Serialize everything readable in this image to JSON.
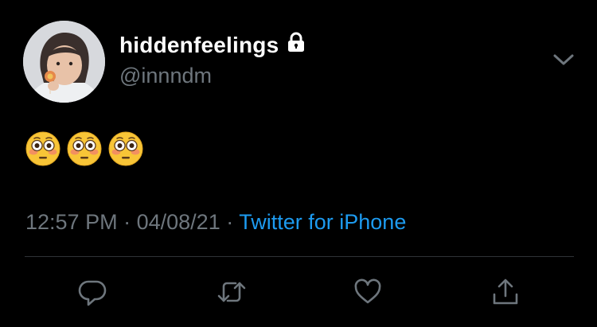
{
  "tweet": {
    "display_name": "hiddenfeelings",
    "handle": "@innndm",
    "text_emojis": [
      "flushed-face",
      "flushed-face",
      "flushed-face"
    ],
    "time": "12:57 PM",
    "date": "04/08/21",
    "separator": "·",
    "source": "Twitter for iPhone"
  },
  "icons": {
    "lock": "lock-icon",
    "more": "chevron-down-icon",
    "reply": "reply-icon",
    "retweet": "retweet-icon",
    "like": "heart-icon",
    "share": "share-icon"
  },
  "colors": {
    "background": "#000000",
    "text": "#ffffff",
    "secondary": "#6e767d",
    "link": "#1d9bf0",
    "divider": "#2f3336"
  }
}
